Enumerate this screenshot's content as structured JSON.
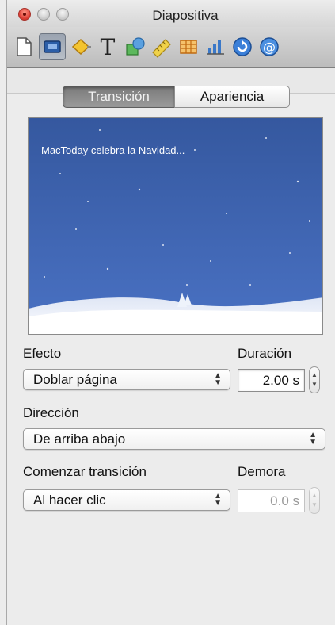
{
  "window": {
    "title": "Diapositiva"
  },
  "toolbar": {
    "tools": [
      {
        "icon": "document-icon"
      },
      {
        "icon": "slide-icon",
        "selected": true
      },
      {
        "icon": "diamond-icon"
      },
      {
        "icon": "text-icon",
        "glyph": "T"
      },
      {
        "icon": "shapes-icon"
      },
      {
        "icon": "ruler-icon"
      },
      {
        "icon": "table-icon"
      },
      {
        "icon": "chart-icon"
      },
      {
        "icon": "quicktime-icon"
      },
      {
        "icon": "at-sign-icon"
      }
    ]
  },
  "tabs": {
    "active": "Transición",
    "inactive": "Apariencia"
  },
  "preview": {
    "caption": "MacToday celebra la Navidad..."
  },
  "effect": {
    "label": "Efecto",
    "value": "Doblar página"
  },
  "duration": {
    "label": "Duración",
    "value": "2.00 s"
  },
  "direction": {
    "label": "Dirección",
    "value": "De arriba abajo"
  },
  "start": {
    "label": "Comenzar transición",
    "value": "Al hacer clic"
  },
  "delay": {
    "label": "Demora",
    "value": "0.0 s"
  },
  "colors": {
    "slide_blue": "#3a5fae",
    "selected_tool": "#9aa3b0"
  }
}
